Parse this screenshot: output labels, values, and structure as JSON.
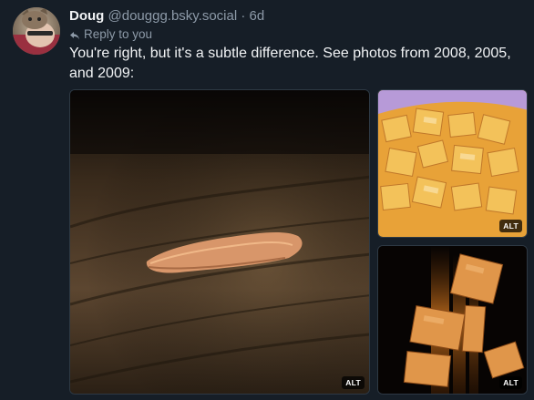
{
  "post": {
    "author_name": "Doug",
    "author_handle": "@douggg.bsky.social",
    "separator": "·",
    "timestamp": "6d",
    "reply_label": "Reply to you",
    "reply_icon": "reply-arrow-icon",
    "text": "You're right, but it's a subtle difference. See photos from 2008, 2005, and 2009:"
  },
  "media": {
    "images": [
      {
        "alt_badge": "ALT",
        "subject": "single cracker on wooden table"
      },
      {
        "alt_badge": "ALT",
        "subject": "bowl of crackers"
      },
      {
        "alt_badge": "ALT",
        "subject": "falling crackers on black background"
      }
    ]
  },
  "colors": {
    "background": "#161e27",
    "text_primary": "#f1f3f5",
    "text_secondary": "#8d9aa8"
  }
}
